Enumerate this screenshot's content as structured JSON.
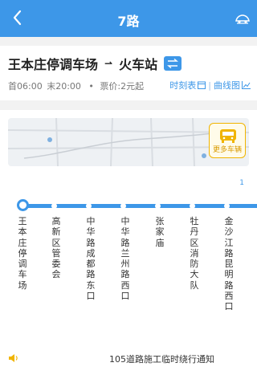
{
  "header": {
    "title": "7路",
    "back_icon": "chevron-left-icon",
    "right_icon": "bus-icon"
  },
  "route": {
    "origin": "王本庄停调车场",
    "destination": "火车站",
    "first_bus": "首06:00",
    "last_bus": "末20:00",
    "separator": "•",
    "fare": "票价:2元起",
    "timetable_label": "时刻表",
    "curve_label": "曲线图"
  },
  "map": {
    "more_buses_label": "更多车辆"
  },
  "page_indicator": "1",
  "stations": [
    "王本庄停调车场",
    "高新区管委会",
    "中华路成都路东口",
    "中华路兰州路西口",
    "张家庙",
    "牡丹区消防大队",
    "金沙江路昆明路西口"
  ],
  "notice": {
    "text": "105道路施工临时绕行通知"
  },
  "colors": {
    "primary": "#3d97e8",
    "accent": "#f0b400",
    "background": "#f2f2f2"
  }
}
